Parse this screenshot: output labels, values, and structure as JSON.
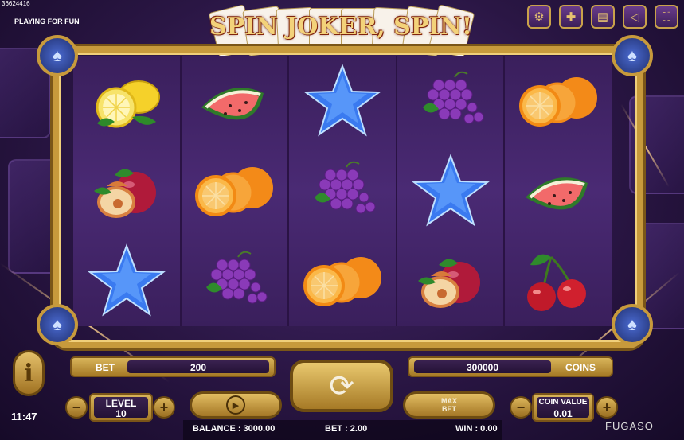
{
  "game_id": "36624416",
  "mode_label": "PLAYING FOR FUN",
  "clock": "11:47",
  "brand": "FUGASO",
  "logo_text": "SPIN JOKER, SPIN!",
  "top_buttons": [
    {
      "name": "settings-icon",
      "glyph": "⚙"
    },
    {
      "name": "language-flag-icon",
      "glyph": "✚"
    },
    {
      "name": "paytable-icon",
      "glyph": "▤"
    },
    {
      "name": "sound-icon",
      "glyph": "🔈"
    },
    {
      "name": "fullscreen-icon",
      "glyph": "⛶"
    }
  ],
  "reels": [
    [
      "lemon",
      "plum",
      "star"
    ],
    [
      "watermelon",
      "orange",
      "grapes"
    ],
    [
      "star",
      "grapes",
      "orange"
    ],
    [
      "grapes",
      "star",
      "plum"
    ],
    [
      "orange",
      "watermelon",
      "cherries"
    ]
  ],
  "controls": {
    "bet_label": "BET",
    "bet_value": "200",
    "coins_value": "300000",
    "coins_label": "COINS",
    "level_label": "LEVEL",
    "level_value": "10",
    "max_bet_label": "MAX",
    "max_bet_label2": "BET",
    "coin_value_label": "COIN VALUE",
    "coin_value": "0.01",
    "minus": "−",
    "plus": "+",
    "info": "i"
  },
  "status": {
    "balance": "BALANCE : 3000.00",
    "bet": "BET : 2.00",
    "win": "WIN : 0.00"
  },
  "colors": {
    "gold": "#c79a3c",
    "purple_bg": "#2a1644"
  }
}
